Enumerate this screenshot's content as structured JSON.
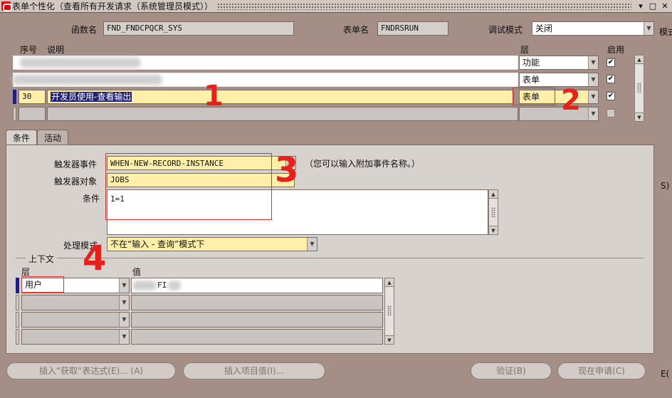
{
  "window": {
    "title": "表单个性化（查看所有开发请求（系统管理员模式））",
    "close_glyph": "✕",
    "right_edge_fragments": [
      "模式",
      "S)",
      "E("
    ]
  },
  "header": {
    "function_label": "函数名",
    "function_value": "FND_FNDCPQCR_SYS",
    "form_label": "表单名",
    "form_value": "FNDRSRUN",
    "debug_label": "调试模式",
    "debug_value": "关闭"
  },
  "rules_table": {
    "columns": {
      "seq": "序号",
      "desc": "说明",
      "level": "层",
      "enabled": "启用"
    },
    "rows": [
      {
        "seq": "",
        "desc": "",
        "level": "功能",
        "enabled": true
      },
      {
        "seq": "",
        "desc": "",
        "level": "表单",
        "enabled": true
      },
      {
        "seq": "30",
        "desc": "开发员使用-查看输出",
        "level": "表单",
        "enabled": true
      },
      {
        "seq": "",
        "desc": "",
        "level": "",
        "enabled": false
      }
    ]
  },
  "tabs": [
    {
      "label": "条件",
      "active": true
    },
    {
      "label": "活动",
      "active": false
    }
  ],
  "condition": {
    "trigger_event_label": "触发器事件",
    "trigger_event_value": "WHEN-NEW-RECORD-INSTANCE",
    "trigger_event_hint": "（您可以输入附加事件名称。）",
    "trigger_object_label": "触发器对象",
    "trigger_object_value": "JOBS",
    "condition_label": "条件",
    "condition_value": "1=1",
    "processing_mode_label": "处理模式",
    "processing_mode_value": "不在“输入 - 查询”模式下"
  },
  "context": {
    "group_label": "上下文",
    "level_label": "层",
    "value_label": "值",
    "rows": [
      {
        "level": "用户",
        "value": "FI"
      },
      {
        "level": "",
        "value": ""
      },
      {
        "level": "",
        "value": ""
      },
      {
        "level": "",
        "value": ""
      }
    ]
  },
  "buttons": {
    "insert_get_expr": "插入“获取”表达式(E)... (A)",
    "insert_item_value": "插入项目值(I)...",
    "validate": "验证(B)",
    "apply_now": "现在申请(C)"
  },
  "annotations": [
    "1",
    "2",
    "3",
    "4"
  ],
  "colors": {
    "background": "#a48e85",
    "current_row": "#ffefa8",
    "annotation_red": "#e8201c",
    "selection_blue": "#21217a"
  }
}
